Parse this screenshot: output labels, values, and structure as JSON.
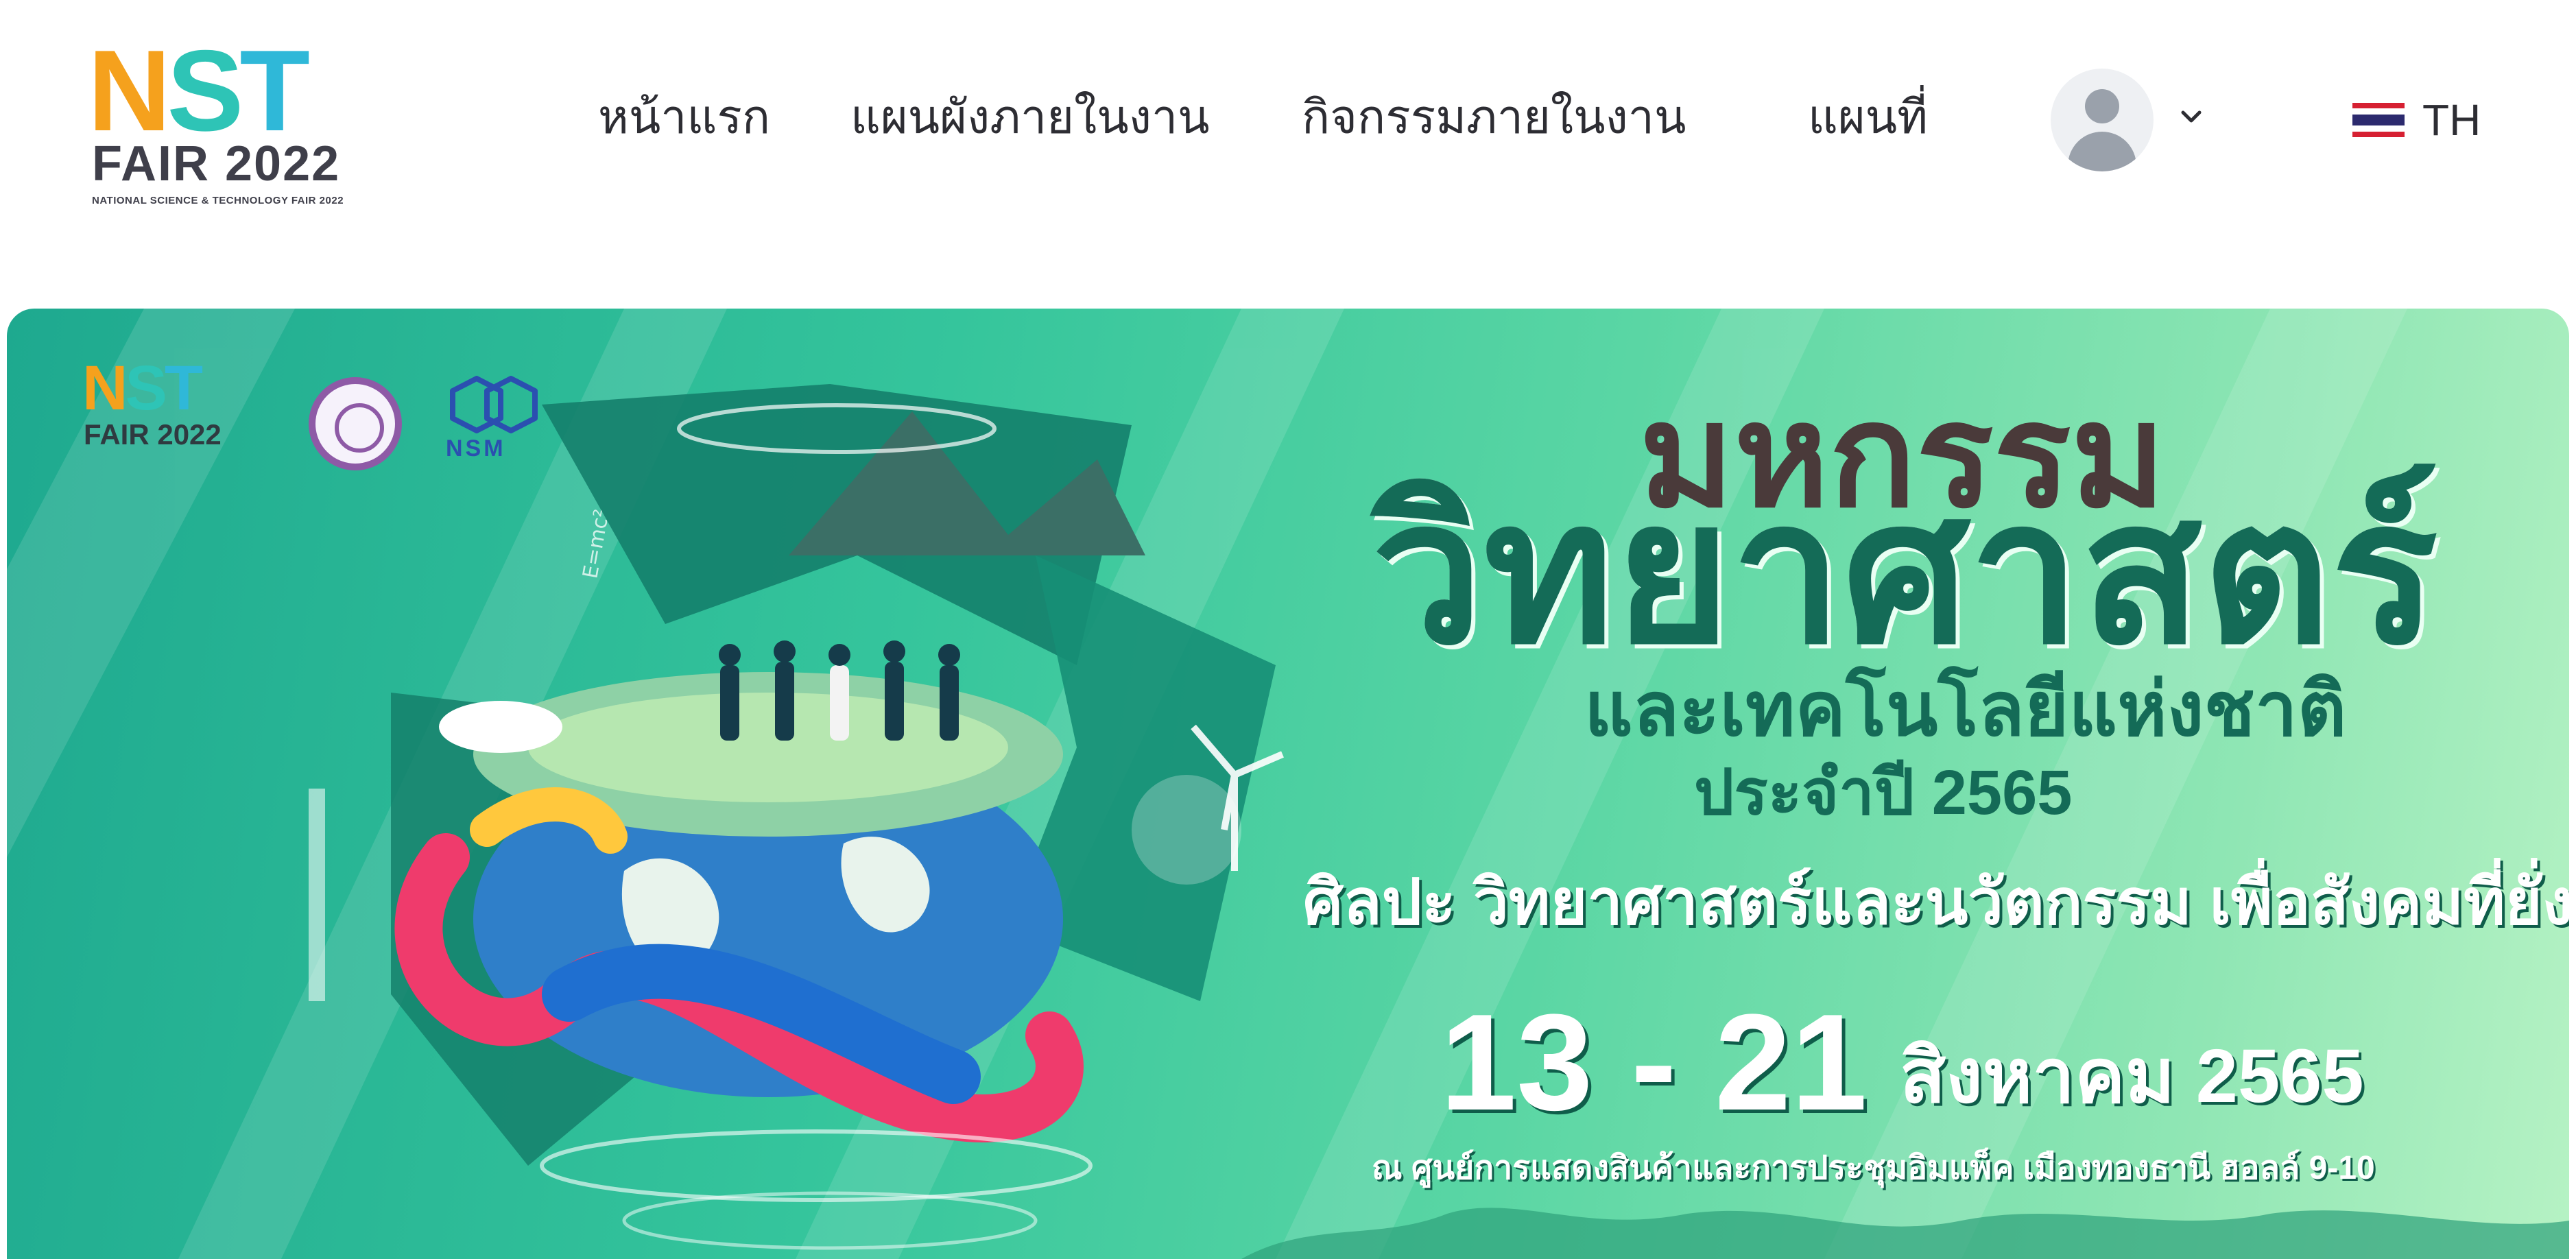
{
  "header": {
    "logo": {
      "brand": "NST",
      "fair": "FAIR 2022",
      "tagline": "NATIONAL SCIENCE & TECHNOLOGY FAIR 2022"
    },
    "nav": [
      {
        "label": "หน้าแรก"
      },
      {
        "label": "แผนผังภายในงาน"
      },
      {
        "label": "กิจกรรมภายในงาน"
      },
      {
        "label": "แผนที่"
      }
    ],
    "user_menu": {
      "icon": "user-avatar-icon",
      "dropdown_icon": "chevron-down-icon"
    },
    "language": {
      "flag_icon": "thailand-flag-icon",
      "label": "TH"
    }
  },
  "banner": {
    "logos": {
      "nst": "NST",
      "fair": "FAIR 2022",
      "nsm": "NSM"
    },
    "title_line1": "มหกรรม",
    "title_line2": "วิทยาศาสตร์",
    "title_line3": "และเทคโนโลยีแห่งชาติ",
    "title_line4": "ประจำปี 2565",
    "slogan": "ศิลปะ วิทยาศาสตร์และนวัตกรรม เพื่อสังคมที่ยั่งยืน",
    "date_range": "13 - 21",
    "date_month": "สิงหาคม 2565",
    "venue": "ณ  ศูนย์การแสดงสินค้าและการประชุมอิมแพ็ค เมืองทองธานี ฮอลล์ 9-10",
    "formula": "E=mc²"
  },
  "colors": {
    "nav_text": "#2d2d33",
    "banner_green_dark": "#146b57",
    "banner_green_light": "#b6f2c4",
    "logo_orange": "#f5a11d",
    "logo_teal": "#2ec4b6"
  }
}
